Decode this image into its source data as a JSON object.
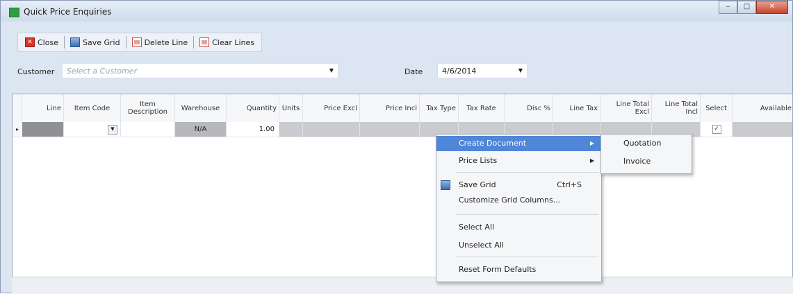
{
  "window": {
    "title": "Quick Price Enquiries",
    "controls": [
      "minimize-icon",
      "maximize-icon",
      "close-icon"
    ]
  },
  "toolbar": {
    "close_label": "Close",
    "save_grid_label": "Save Grid",
    "delete_line_label": "Delete Line",
    "clear_lines_label": "Clear Lines"
  },
  "filters": {
    "customer_label": "Customer",
    "customer_placeholder": "Select a Customer",
    "date_label": "Date",
    "date_value": "4/6/2014"
  },
  "grid": {
    "columns": [
      "Line",
      "Item Code",
      "Item Description",
      "Warehouse",
      "Quantity",
      "Units",
      "Price Excl",
      "Price Incl",
      "Tax Type",
      "Tax Rate",
      "Disc %",
      "Line Tax",
      "Line Total Excl",
      "Line Total Incl",
      "Select",
      "Available"
    ],
    "row": {
      "indicator": "▸",
      "warehouse": "N/A",
      "quantity": "1.00",
      "select_checked": true
    }
  },
  "context_menu": {
    "items": [
      {
        "label": "Create Document",
        "has_submenu": true,
        "highlighted": true
      },
      {
        "label": "Price Lists",
        "has_submenu": true
      },
      {
        "label": "Save Grid",
        "shortcut": "Ctrl+S",
        "icon": "save-icon"
      },
      {
        "label": "Customize Grid Columns..."
      },
      {
        "label": "Select All"
      },
      {
        "label": "Unselect All"
      },
      {
        "label": "Reset Form Defaults"
      }
    ],
    "submenu": [
      "Quotation",
      "Invoice"
    ]
  },
  "colors": {
    "menu_highlight": "#4f86d8",
    "title_bar": "#dce6f2",
    "close_button": "#c8452c"
  }
}
